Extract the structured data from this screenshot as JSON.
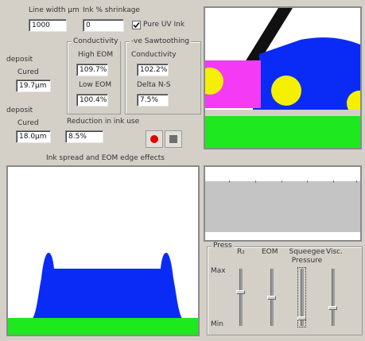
{
  "controls": {
    "line_width_label": "Line width µm",
    "line_width_value": "1000",
    "ink_shrinkage_label": "Ink % shrinkage",
    "ink_shrinkage_value": "0",
    "pure_uv_label": "Pure UV Ink",
    "pure_uv_checked": true
  },
  "left_col": {
    "deposit1_label": "deposit",
    "cured1_label": "Cured",
    "cured1_value": "19.7µm",
    "deposit2_label": "deposit",
    "cured2_label": "Cured",
    "cured2_value": "18.0µm"
  },
  "conductivity": {
    "title": "Conductivity",
    "high_label": "High EOM",
    "high_value": "109.7%",
    "low_label": "Low EOM",
    "low_value": "100.4%"
  },
  "sawtooth": {
    "title": "-ve Sawtoothing",
    "cond_label": "Conductivity",
    "cond_value": "102.2%",
    "delta_label": "Delta N-S",
    "delta_value": "7.5%"
  },
  "reduction": {
    "label": "Reduction in ink use",
    "value": "8.5%"
  },
  "caption": "Ink spread and EOM edge effects",
  "press": {
    "title": "Press",
    "cols": [
      "R₂",
      "EOM",
      "Squeegee Pressure",
      "Visc."
    ],
    "max_label": "Max",
    "min_label": "Min"
  },
  "colors": {
    "blue": "#0a2bf5",
    "green": "#1ee81e",
    "magenta": "#f53af5",
    "yellow": "#f5f000",
    "record": "#e00000"
  }
}
